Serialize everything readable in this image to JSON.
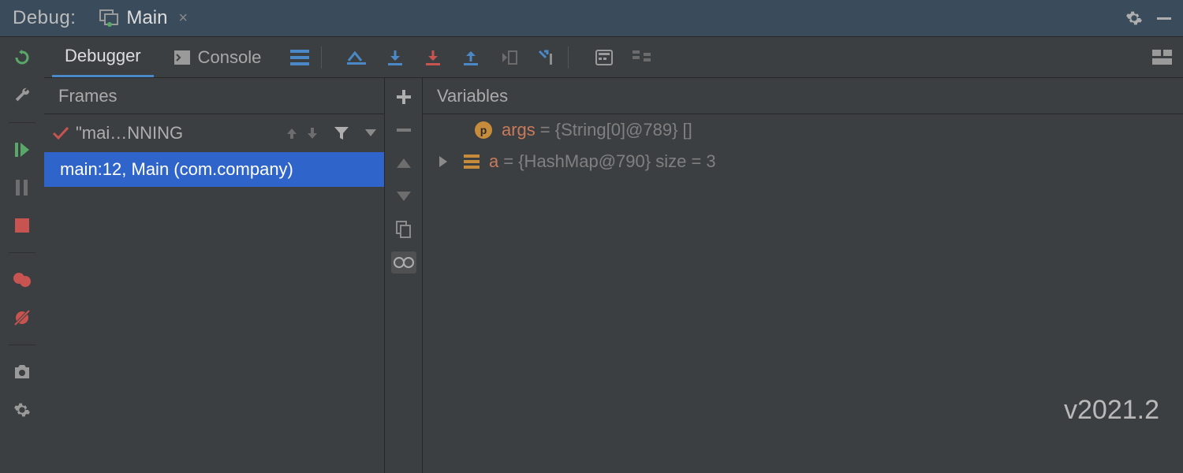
{
  "header": {
    "panel_label": "Debug:",
    "run_config": "Main"
  },
  "tabs": {
    "debugger": "Debugger",
    "console": "Console"
  },
  "frames": {
    "title": "Frames",
    "thread": "\"mai…NNING",
    "selected_frame": "main:12, Main (com.company)"
  },
  "variables": {
    "title": "Variables",
    "rows": [
      {
        "badge": "p",
        "name": "args",
        "rest": " = {String[0]@789} []"
      },
      {
        "name": "a",
        "rest": " = {HashMap@790}  size = 3"
      }
    ]
  },
  "version": "v2021.2"
}
